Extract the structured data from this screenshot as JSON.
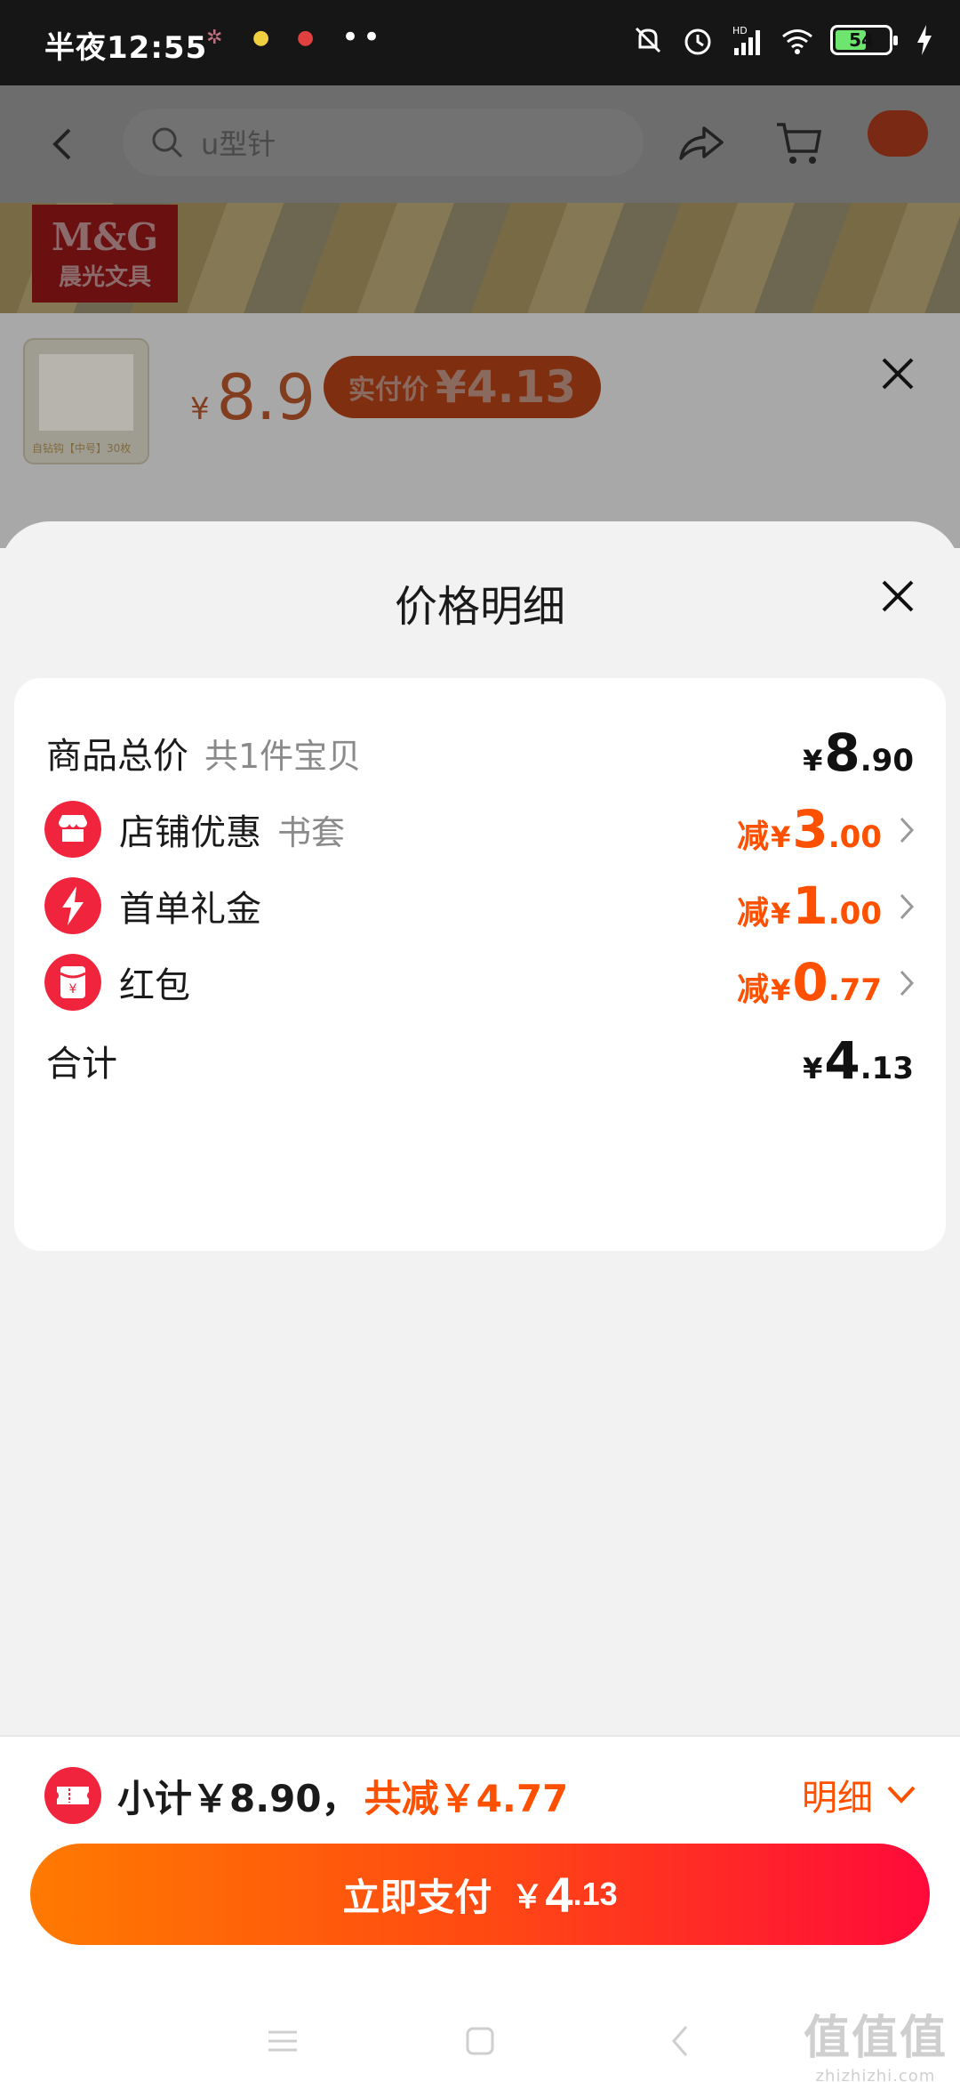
{
  "status_bar": {
    "time": "半夜12:55",
    "battery": "54",
    "network": "HD"
  },
  "product_page": {
    "search_text": "u型针",
    "brand_line1": "M&G",
    "brand_line2": "晨光文具",
    "thumb_caption": "自钻钩【中号】30枚",
    "price_currency": "¥",
    "price": "8.9",
    "paid_label": "实付价",
    "paid_value": "¥4.13"
  },
  "sheet": {
    "title": "价格明细",
    "rows": [
      {
        "label": "商品总价",
        "sub": "共1件宝贝",
        "prefix": "",
        "currency": "¥",
        "int": "8",
        "dec": ".90"
      },
      {
        "label": "店铺优惠",
        "sub": "书套",
        "prefix": "减",
        "currency": "¥",
        "int": "3",
        "dec": ".00"
      },
      {
        "label": "首单礼金",
        "sub": "",
        "prefix": "减",
        "currency": "¥",
        "int": "1",
        "dec": ".00"
      },
      {
        "label": "红包",
        "sub": "",
        "prefix": "减",
        "currency": "¥",
        "int": "0",
        "dec": ".77"
      },
      {
        "label": "合计",
        "sub": "",
        "prefix": "",
        "currency": "¥",
        "int": "4",
        "dec": ".13"
      }
    ]
  },
  "bottom_bar": {
    "subtotal": "小计￥8.90，",
    "saved": "共减￥4.77",
    "detail_label": "明细",
    "pay_label": "立即支付",
    "pay_currency": "￥",
    "pay_int": "4",
    "pay_dec": ".13"
  },
  "watermark": {
    "line1": "值值值",
    "line2": "zhizhizhi.com"
  },
  "colors": {
    "accent": "#ff5000",
    "pay_gradient_start": "#ff7a00",
    "pay_gradient_end": "#ff0a3a",
    "icon_red": "#f0243c"
  }
}
